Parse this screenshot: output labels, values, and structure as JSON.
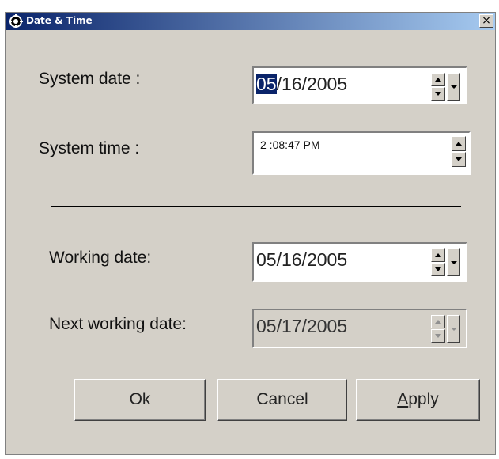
{
  "window": {
    "title": "Date & Time",
    "close_label": "×"
  },
  "system_date": {
    "label": "System date :",
    "selected_part": "05",
    "rest": "/16/2005"
  },
  "system_time": {
    "label": "System time :",
    "value": "2 :08:47 PM"
  },
  "working_date": {
    "label": "Working date:",
    "value": "05/16/2005"
  },
  "next_working_date": {
    "label": "Next working date:",
    "value": "05/17/2005"
  },
  "buttons": {
    "ok": "Ok",
    "cancel": "Cancel",
    "apply_mnemonic": "A",
    "apply_rest": "pply"
  },
  "colors": {
    "title_start": "#0a246a",
    "title_end": "#a6caf0",
    "face": "#d4d0c8",
    "selection": "#0a246a"
  }
}
